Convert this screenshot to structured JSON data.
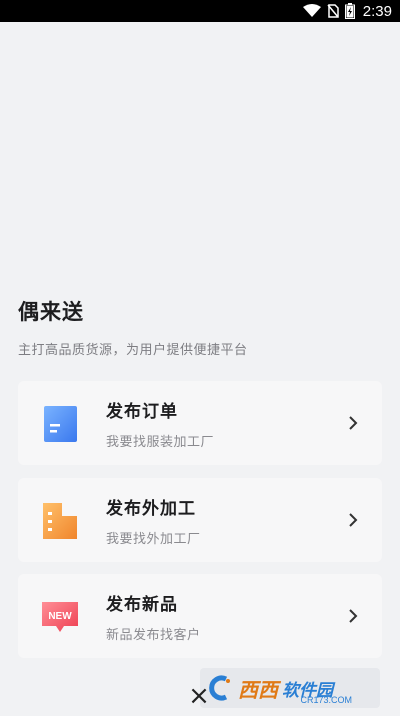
{
  "status_bar": {
    "time": "2:39",
    "icons": [
      "wifi-icon",
      "no-sim-icon",
      "battery-charging-icon"
    ]
  },
  "header": {
    "title": "偶来送",
    "subtitle": "主打高品质货源，为用户提供便捷平台"
  },
  "cards": [
    {
      "title": "发布订单",
      "desc": "我要找服装加工厂",
      "icon": "document-icon",
      "accent": "#4a8df2"
    },
    {
      "title": "发布外加工",
      "desc": "我要找外加工厂",
      "icon": "building-icon",
      "accent": "#f5a24b"
    },
    {
      "title": "发布新品",
      "desc": "新品发布找客户",
      "icon": "new-badge-icon",
      "accent": "#f04e5e",
      "badge_text": "NEW"
    }
  ],
  "overlay": {
    "close_symbol": "×"
  },
  "watermark": {
    "brand": "西西",
    "name": "软件园",
    "site": "CR173.COM"
  }
}
